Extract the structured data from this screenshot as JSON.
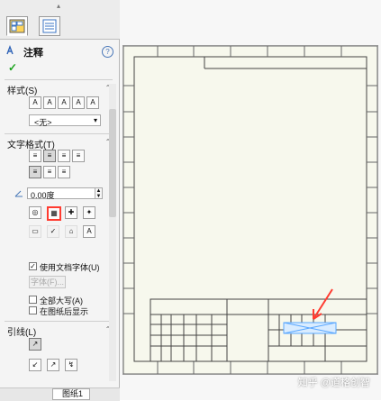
{
  "window": {
    "tabs": [
      "property-manager",
      "configuration-manager"
    ]
  },
  "panel": {
    "title": "注释",
    "help_icon": "?",
    "check_icon": "✓",
    "sections": {
      "style": {
        "label": "样式(S)",
        "dropdown_value": "<无>"
      },
      "text_format": {
        "label": "文字格式(T)",
        "angle_value": "0.00度",
        "use_doc_font": "使用文档字体(U)",
        "font_button": "字体(F)...",
        "all_caps": "全部大写(A)",
        "show_after_sheet": "在图纸后显示"
      },
      "leader": {
        "label": "引线(L)"
      }
    },
    "sheet_tab": "图纸1"
  },
  "canvas": {
    "watermark": "知乎 @道格创智"
  },
  "colors": {
    "accent": "#ff3b30",
    "sheet_bg": "#f7f8ed",
    "panel_bg": "#f4f4f4"
  }
}
